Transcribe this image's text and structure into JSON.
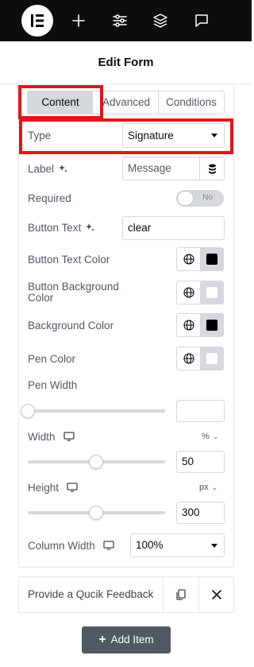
{
  "panel": {
    "title": "Edit Form"
  },
  "tabs": [
    {
      "label": "Content",
      "active": true
    },
    {
      "label": "Advanced",
      "active": false
    },
    {
      "label": "Conditions",
      "active": false
    }
  ],
  "fields": {
    "type": {
      "label": "Type",
      "value": "Signature"
    },
    "label": {
      "label": "Label",
      "placeholder": "Message"
    },
    "required": {
      "label": "Required",
      "toggle_text": "No",
      "on": false
    },
    "button_text": {
      "label": "Button Text",
      "value": "clear"
    },
    "button_text_color": {
      "label": "Button Text Color",
      "swatch": "#000000"
    },
    "button_bg_color": {
      "label_line1": "Button Background",
      "label_line2": "Color",
      "swatch": "#ffffff"
    },
    "background_color": {
      "label": "Background Color",
      "swatch": "#000000"
    },
    "pen_color": {
      "label": "Pen Color",
      "swatch": "#ffffff"
    },
    "pen_width": {
      "label": "Pen Width",
      "value": "",
      "slider_fraction": 0.0
    },
    "width": {
      "label": "Width",
      "unit": "%",
      "value": "50",
      "slider_fraction": 0.5
    },
    "height": {
      "label": "Height",
      "unit": "px",
      "value": "300",
      "slider_fraction": 0.5
    },
    "column_width": {
      "label": "Column Width",
      "value": "100%"
    }
  },
  "item": {
    "label": "Provide a Qucik Feedback"
  },
  "add_item": {
    "label": "Add Item"
  },
  "icons": {
    "logo": "elementor-logo-icon",
    "topbar": [
      "plus-icon",
      "sliders-icon",
      "layers-icon",
      "chat-icon"
    ]
  },
  "colors": {
    "highlight": "#e3151b",
    "topbar": "#0c0d0e",
    "button": "#515962"
  }
}
